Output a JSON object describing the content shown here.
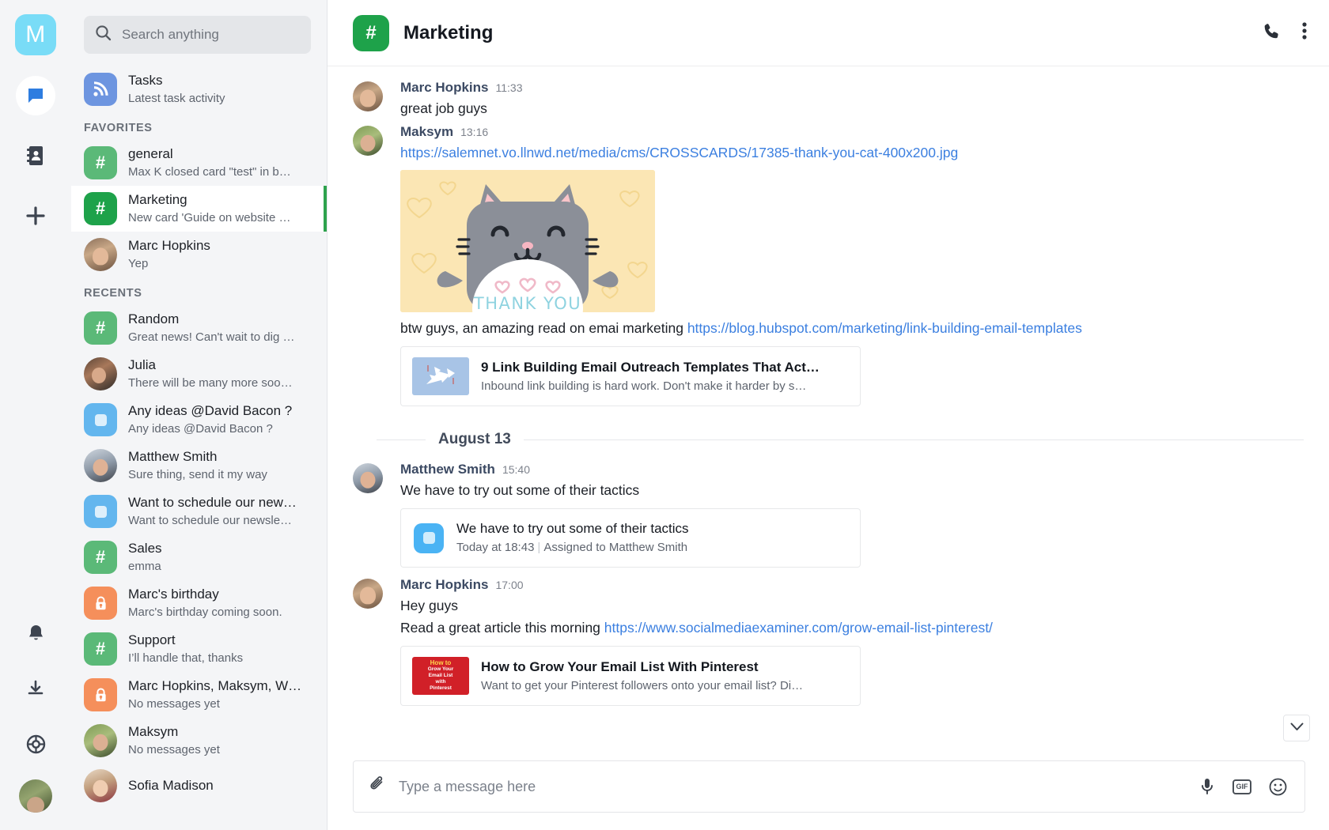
{
  "rail": {
    "logo_label": "M",
    "icons": [
      {
        "name": "chat-icon",
        "label": "Chat"
      },
      {
        "name": "contacts-icon",
        "label": "Contacts"
      },
      {
        "name": "plus-icon",
        "label": "Add"
      },
      {
        "name": "bell-icon",
        "label": "Notifications"
      },
      {
        "name": "download-icon",
        "label": "Downloads"
      },
      {
        "name": "help-icon",
        "label": "Help"
      }
    ]
  },
  "search": {
    "placeholder": "Search anything",
    "value": "",
    "icon": "search-icon"
  },
  "sidebar": {
    "tasks": {
      "title": "Tasks",
      "subtitle": "Latest task activity",
      "icon": "rss-icon"
    },
    "favorites_label": "FAVORITES",
    "recents_label": "RECENTS",
    "favorites": [
      {
        "name": "general",
        "sub": "Max K closed card \"test\" in b…",
        "icon": "hash-icon",
        "kind": "green",
        "selected": false
      },
      {
        "name": "Marketing",
        "sub": "New card 'Guide on website …",
        "icon": "hash-icon",
        "kind": "green-d",
        "selected": true
      },
      {
        "name": "Marc Hopkins",
        "sub": "Yep",
        "icon": "avatar",
        "kind": "marc",
        "selected": false
      }
    ],
    "recents": [
      {
        "name": "Random",
        "sub": "Great news! Can't wait to dig …",
        "icon": "hash-icon",
        "kind": "green"
      },
      {
        "name": "Julia",
        "sub": "There will be many more soo…",
        "icon": "avatar",
        "kind": "julia"
      },
      {
        "name": "Any ideas @David Bacon ?",
        "sub": "Any ideas @David Bacon ?",
        "icon": "task-icon",
        "kind": "lblue"
      },
      {
        "name": "Matthew Smith",
        "sub": "Sure thing, send it my way",
        "icon": "avatar",
        "kind": "matthew"
      },
      {
        "name": "Want to schedule our new…",
        "sub": "Want to schedule our newsle…",
        "icon": "task-icon",
        "kind": "lblue"
      },
      {
        "name": "Sales",
        "sub": "emma",
        "icon": "hash-icon",
        "kind": "green"
      },
      {
        "name": "Marc's birthday",
        "sub": "Marc's birthday coming soon.",
        "icon": "lock-icon",
        "kind": "orange"
      },
      {
        "name": "Support",
        "sub": "I’ll handle that, thanks",
        "icon": "hash-icon",
        "kind": "green"
      },
      {
        "name": "Marc Hopkins, Maksym, W…",
        "sub": "No messages yet",
        "icon": "lock-icon",
        "kind": "orange"
      },
      {
        "name": "Maksym",
        "sub": "No messages yet",
        "icon": "avatar",
        "kind": "maksym"
      },
      {
        "name": "Sofia Madison",
        "sub": "",
        "icon": "avatar",
        "kind": "sofia"
      }
    ]
  },
  "chat": {
    "title": "Marketing",
    "avatar_icon": "hash-icon",
    "actions": [
      {
        "name": "call-icon",
        "label": "Call"
      },
      {
        "name": "more-options-icon",
        "label": "More"
      }
    ],
    "date_divider": "August 13",
    "messages": [
      {
        "author": "Marc Hopkins",
        "time": "11:33",
        "avatar": "marc",
        "lines": [
          {
            "type": "text",
            "text": "great job guys"
          }
        ]
      },
      {
        "author": "Maksym",
        "time": "13:16",
        "avatar": "maksym",
        "lines": [
          {
            "type": "link",
            "text": "https://salemnet.vo.llnwd.net/media/cms/CROSSCARDS/17385-thank-you-cat-400x200.jpg"
          },
          {
            "type": "image",
            "alt": "thank-you-cat",
            "caption": "THANK YOU"
          },
          {
            "type": "text_link",
            "text": "btw guys, an amazing read on emai marketing ",
            "link": "https://blog.hubspot.com/marketing/link-building-email-templates"
          },
          {
            "type": "preview",
            "thumb": "paper-airplane-thumb",
            "title": "9 Link Building Email Outreach Templates That Act…",
            "desc": "Inbound link building is hard work. Don't make it harder by s…"
          }
        ]
      },
      {
        "author": "Matthew Smith",
        "time": "15:40",
        "avatar": "matthew",
        "lines": [
          {
            "type": "text",
            "text": "We have to try out some of their tactics"
          },
          {
            "type": "task",
            "title": "We have to try out some of their tactics",
            "meta_date": "Today at 18:43",
            "meta_assign_label": "Assigned to",
            "meta_assignee": "Matthew Smith"
          }
        ]
      },
      {
        "author": "Marc Hopkins",
        "time": "17:00",
        "avatar": "marc",
        "lines": [
          {
            "type": "text",
            "text": "Hey guys"
          },
          {
            "type": "text_link",
            "text": "Read a great article this morning ",
            "link": "https://www.socialmediaexaminer.com/grow-email-list-pinterest/"
          },
          {
            "type": "preview",
            "thumb": "pinterest-thumb",
            "title": "How to Grow Your Email List With Pinterest",
            "desc": "Want to get your Pinterest followers onto your email list? Di…",
            "thumb_lines": [
              "How to",
              "Grow Your",
              "Email List",
              "with",
              "Pinterest"
            ]
          }
        ]
      }
    ]
  },
  "composer": {
    "placeholder": "Type a message here",
    "value": "",
    "attach_icon": "paperclip-icon",
    "icons": [
      {
        "name": "microphone-icon",
        "label": "Voice"
      },
      {
        "name": "gif-icon",
        "label": "GIF"
      },
      {
        "name": "emoji-icon",
        "label": "Emoji"
      }
    ]
  },
  "colors": {
    "brand_green": "#1ea24a",
    "link_blue": "#3b7fe0",
    "logo_cyan": "#79dcf7",
    "accent_orange": "#f58f5b",
    "task_blue": "#4ab3f4"
  }
}
